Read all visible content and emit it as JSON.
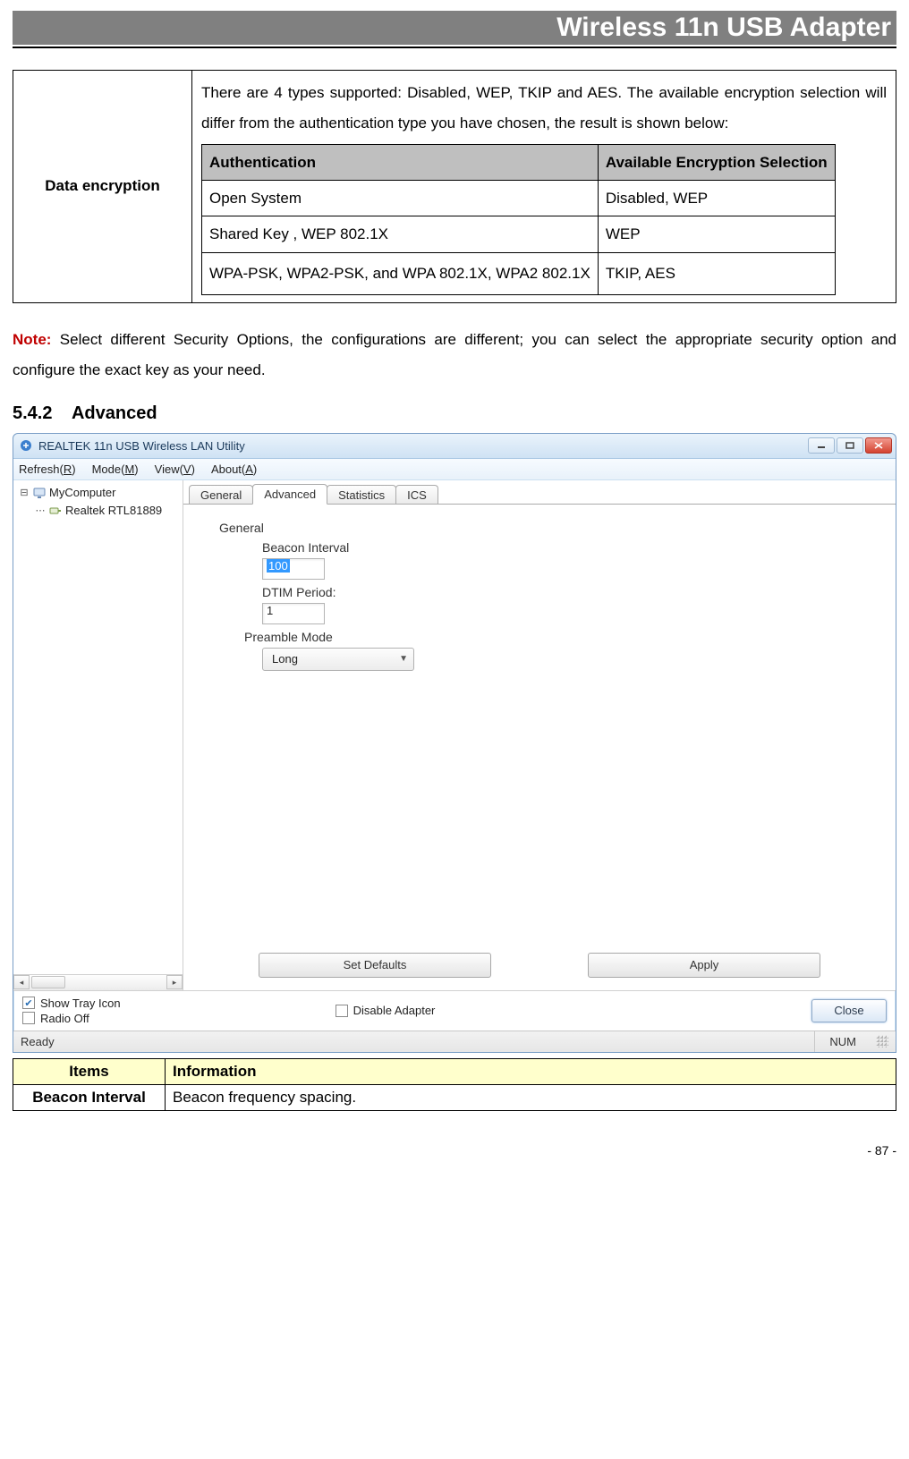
{
  "header": {
    "title": "Wireless 11n USB Adapter"
  },
  "encryption": {
    "label": "Data encryption",
    "desc": "There are 4 types supported: Disabled, WEP, TKIP and AES. The available encryption selection will differ from the authentication type you have chosen, the result is shown below:",
    "cols": {
      "auth": "Authentication",
      "sel": "Available Encryption Selection"
    },
    "rows": [
      {
        "auth": "Open System",
        "sel": "Disabled, WEP"
      },
      {
        "auth": "Shared Key , WEP 802.1X",
        "sel": "WEP"
      },
      {
        "auth": "WPA-PSK, WPA2-PSK, and WPA 802.1X, WPA2 802.1X",
        "sel": "TKIP, AES"
      }
    ]
  },
  "note": {
    "label": "Note:",
    "text": "Select different Security Options, the configurations are different; you can select the appropriate security option and configure the exact key as your need."
  },
  "section": {
    "num": "5.4.2",
    "title": "Advanced"
  },
  "app": {
    "title": "REALTEK 11n USB Wireless LAN Utility",
    "menu": {
      "refresh": "Refresh(R)",
      "mode": "Mode(M)",
      "view": "View(V)",
      "about": "About(A)"
    },
    "tree": {
      "root": "MyComputer",
      "child": "Realtek RTL81889"
    },
    "tabs": {
      "general": "General",
      "advanced": "Advanced",
      "statistics": "Statistics",
      "ics": "ICS"
    },
    "panel": {
      "group": "General",
      "beacon_label": "Beacon Interval",
      "beacon_value": "100",
      "dtim_label": "DTIM Period:",
      "dtim_value": "1",
      "preamble_label": "Preamble Mode",
      "preamble_value": "Long",
      "set_defaults": "Set Defaults",
      "apply": "Apply"
    },
    "options": {
      "show_tray": "Show Tray Icon",
      "radio_off": "Radio Off",
      "disable_adapter": "Disable Adapter",
      "close": "Close"
    },
    "status": {
      "ready": "Ready",
      "num": "NUM"
    }
  },
  "info_table": {
    "h1": "Items",
    "h2": "Information",
    "r1c1": "Beacon Interval",
    "r1c2": "Beacon frequency spacing."
  },
  "page": "- 87 -"
}
